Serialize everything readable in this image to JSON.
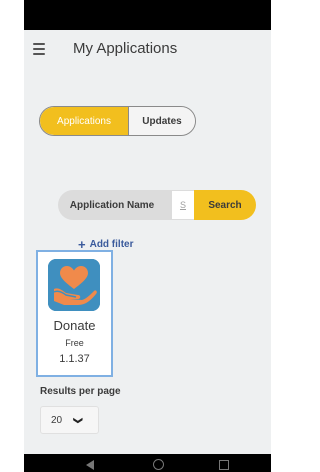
{
  "header": {
    "title": "My Applications",
    "menu_icon": "hamburger-menu-icon"
  },
  "tabs": [
    {
      "label": "Applications",
      "active": true
    },
    {
      "label": "Updates",
      "active": false
    }
  ],
  "search": {
    "field_selected": "Application Name",
    "input_value": "S",
    "button_label": "Search"
  },
  "filter": {
    "add_label": "Add filter"
  },
  "app": {
    "name": "Donate",
    "price": "Free",
    "version": "1.1.37",
    "icon": "heart-in-hand-icon"
  },
  "pagination": {
    "results_label": "Results per page",
    "results_value": "20"
  },
  "colors": {
    "accent": "#f2bf1e",
    "link": "#3a5a9c",
    "icon_bg": "#3f8fbf",
    "heart": "#f08a4b"
  }
}
